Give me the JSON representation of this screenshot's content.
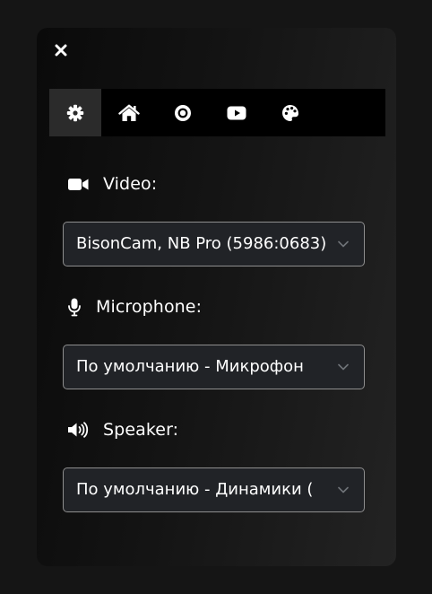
{
  "toolbar": {
    "close_icon": "close-icon",
    "tabs": [
      {
        "icon": "gear-icon",
        "active": true
      },
      {
        "icon": "home-icon",
        "active": false
      },
      {
        "icon": "record-icon",
        "active": false
      },
      {
        "icon": "youtube-icon",
        "active": false
      },
      {
        "icon": "palette-icon",
        "active": false
      }
    ]
  },
  "video": {
    "label": "Video:",
    "icon": "video-camera-icon",
    "selected": "BisonCam, NB Pro (5986:0683)"
  },
  "microphone": {
    "label": "Microphone:",
    "icon": "microphone-icon",
    "selected": "По умолчанию - Микрофон"
  },
  "speaker": {
    "label": "Speaker:",
    "icon": "speaker-icon",
    "selected": "По умолчанию - Динамики ("
  },
  "colors": {
    "accent_active_tab": "#2b2b2b",
    "tabbar_bg": "#000000",
    "select_bg": "#212327",
    "select_border": "#8e8e8e"
  }
}
